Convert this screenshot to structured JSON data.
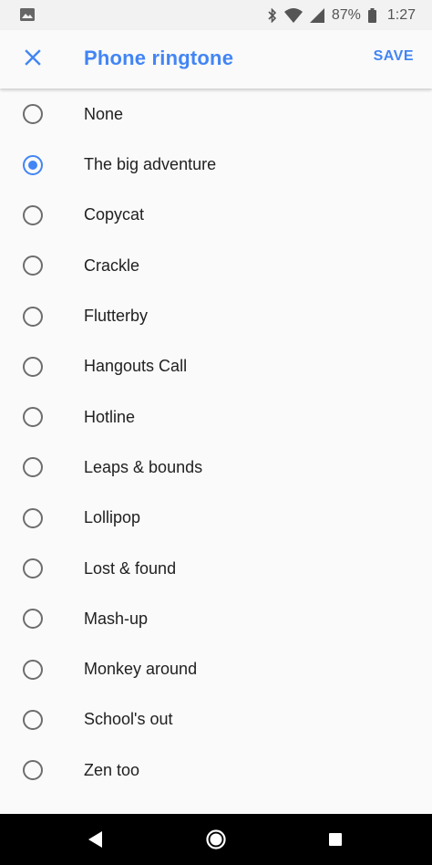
{
  "status_bar": {
    "battery": "87%",
    "time": "1:27",
    "icons": [
      "image-icon",
      "bluetooth-icon",
      "wifi-icon",
      "cellular-icon",
      "battery-icon"
    ]
  },
  "app_bar": {
    "close_icon": "close-icon",
    "title": "Phone ringtone",
    "save_label": "SAVE"
  },
  "ringtones": [
    {
      "label": "None",
      "selected": false
    },
    {
      "label": "The big adventure",
      "selected": true
    },
    {
      "label": "Copycat",
      "selected": false
    },
    {
      "label": "Crackle",
      "selected": false
    },
    {
      "label": "Flutterby",
      "selected": false
    },
    {
      "label": "Hangouts Call",
      "selected": false
    },
    {
      "label": "Hotline",
      "selected": false
    },
    {
      "label": "Leaps & bounds",
      "selected": false
    },
    {
      "label": "Lollipop",
      "selected": false
    },
    {
      "label": "Lost & found",
      "selected": false
    },
    {
      "label": "Mash-up",
      "selected": false
    },
    {
      "label": "Monkey around",
      "selected": false
    },
    {
      "label": "School's out",
      "selected": false
    },
    {
      "label": "Zen too",
      "selected": false
    }
  ],
  "colors": {
    "accent": "#4285f4",
    "text": "#212121",
    "radio_unchecked": "#6d6d6d",
    "background": "#fafafa"
  },
  "nav_bar": {
    "icons": [
      "back-icon",
      "home-icon",
      "recents-icon"
    ]
  }
}
